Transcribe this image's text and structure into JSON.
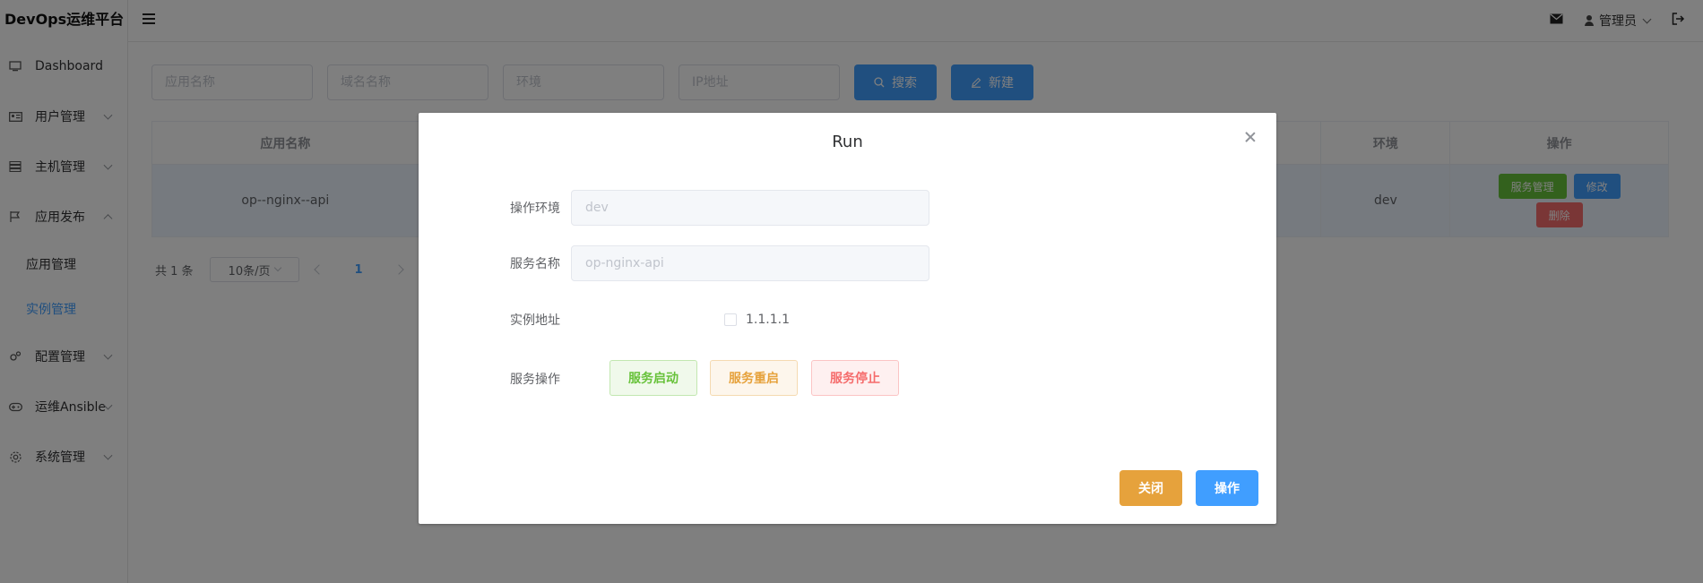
{
  "app": {
    "title": "DevOps运维平台"
  },
  "sidebar": {
    "items": [
      {
        "label": "Dashboard",
        "icon": "monitor-icon"
      },
      {
        "label": "用户管理",
        "icon": "id-card-icon"
      },
      {
        "label": "主机管理",
        "icon": "server-icon"
      },
      {
        "label": "应用发布",
        "icon": "flag-icon"
      },
      {
        "label": "配置管理",
        "icon": "cogs-icon"
      },
      {
        "label": "运维Ansible",
        "icon": "gamepad-icon"
      },
      {
        "label": "系统管理",
        "icon": "gear-icon"
      }
    ],
    "sub_items": [
      {
        "label": "应用管理"
      },
      {
        "label": "实例管理"
      }
    ]
  },
  "header": {
    "user": "管理员"
  },
  "search": {
    "app_placeholder": "应用名称",
    "domain_placeholder": "域名名称",
    "env_placeholder": "环境",
    "ip_placeholder": "IP地址",
    "search_label": "搜索",
    "new_label": "新建"
  },
  "table": {
    "columns": [
      "应用名称",
      "环境",
      "操作"
    ],
    "rows": [
      {
        "app": "op--nginx--api",
        "env": "dev"
      }
    ],
    "actions": {
      "service": "服务管理",
      "edit": "修改",
      "delete": "删除"
    }
  },
  "pager": {
    "total": "共 1 条",
    "size": "10条/页",
    "page": "1"
  },
  "dialog": {
    "title": "Run",
    "env_label": "操作环境",
    "env_value": "dev",
    "service_label": "服务名称",
    "service_value": "op-nginx-api",
    "instance_label": "实例地址",
    "instance_ip": "1.1.1.1",
    "op_label": "服务操作",
    "start": "服务启动",
    "restart": "服务重启",
    "stop": "服务停止",
    "close": "关闭",
    "submit": "操作"
  },
  "colors": {
    "primary": "#409eff",
    "success": "#67c23a",
    "warning": "#e6a23c",
    "danger": "#f56c6c"
  }
}
